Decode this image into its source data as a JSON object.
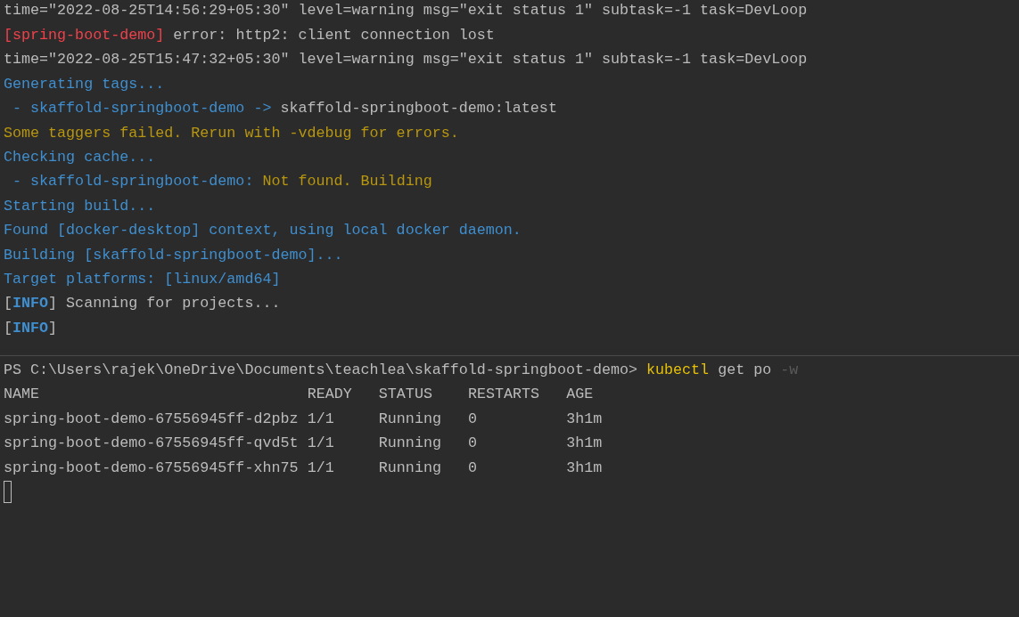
{
  "log_lines": [
    [
      {
        "kind": "plain",
        "text": "time=\"2022-08-25T14:56:29+05:30\" level=warning msg=\"exit status 1\" subtask=-1 task=DevLoop"
      }
    ],
    [
      {
        "kind": "error",
        "text": "[spring-boot-demo]"
      },
      {
        "kind": "plain",
        "text": " error: http2: client connection lost"
      }
    ],
    [
      {
        "kind": "plain",
        "text": "time=\"2022-08-25T15:47:32+05:30\" level=warning msg=\"exit status 1\" subtask=-1 task=DevLoop"
      }
    ],
    [
      {
        "kind": "info",
        "text": "Generating tags..."
      }
    ],
    [
      {
        "kind": "info",
        "text": " - skaffold-springboot-demo ->"
      },
      {
        "kind": "plain",
        "text": " skaffold-springboot-demo:latest"
      }
    ],
    [
      {
        "kind": "warn",
        "text": "Some taggers failed. Rerun with -vdebug for errors."
      }
    ],
    [
      {
        "kind": "info",
        "text": "Checking cache..."
      }
    ],
    [
      {
        "kind": "info",
        "text": " - skaffold-springboot-demo:"
      },
      {
        "kind": "warn",
        "text": " Not found. Building"
      }
    ],
    [
      {
        "kind": "info",
        "text": "Starting build..."
      }
    ],
    [
      {
        "kind": "info",
        "text": "Found [docker-desktop] context, using local docker daemon."
      }
    ],
    [
      {
        "kind": "info",
        "text": "Building [skaffold-springboot-demo]..."
      }
    ],
    [
      {
        "kind": "info",
        "text": "Target platforms: [linux/amd64]"
      }
    ],
    [
      {
        "kind": "plain",
        "text": "["
      },
      {
        "kind": "tag",
        "text": "INFO"
      },
      {
        "kind": "plain",
        "text": "] Scanning for projects..."
      }
    ],
    [
      {
        "kind": "plain",
        "text": "["
      },
      {
        "kind": "tag",
        "text": "INFO"
      },
      {
        "kind": "plain",
        "text": "]"
      }
    ]
  ],
  "terminal": {
    "prompt": "PS C:\\Users\\rajek\\OneDrive\\Documents\\teachlea\\skaffold-springboot-demo>",
    "command": "kubectl",
    "arguments": "get po",
    "flag": "-w",
    "table": {
      "columns": [
        "NAME",
        "READY",
        "STATUS",
        "RESTARTS",
        "AGE"
      ],
      "rows": [
        [
          "spring-boot-demo-67556945ff-d2pbz",
          "1/1",
          "Running",
          "0",
          "3h1m"
        ],
        [
          "spring-boot-demo-67556945ff-qvd5t",
          "1/1",
          "Running",
          "0",
          "3h1m"
        ],
        [
          "spring-boot-demo-67556945ff-xhn75",
          "1/1",
          "Running",
          "0",
          "3h1m"
        ]
      ]
    }
  }
}
